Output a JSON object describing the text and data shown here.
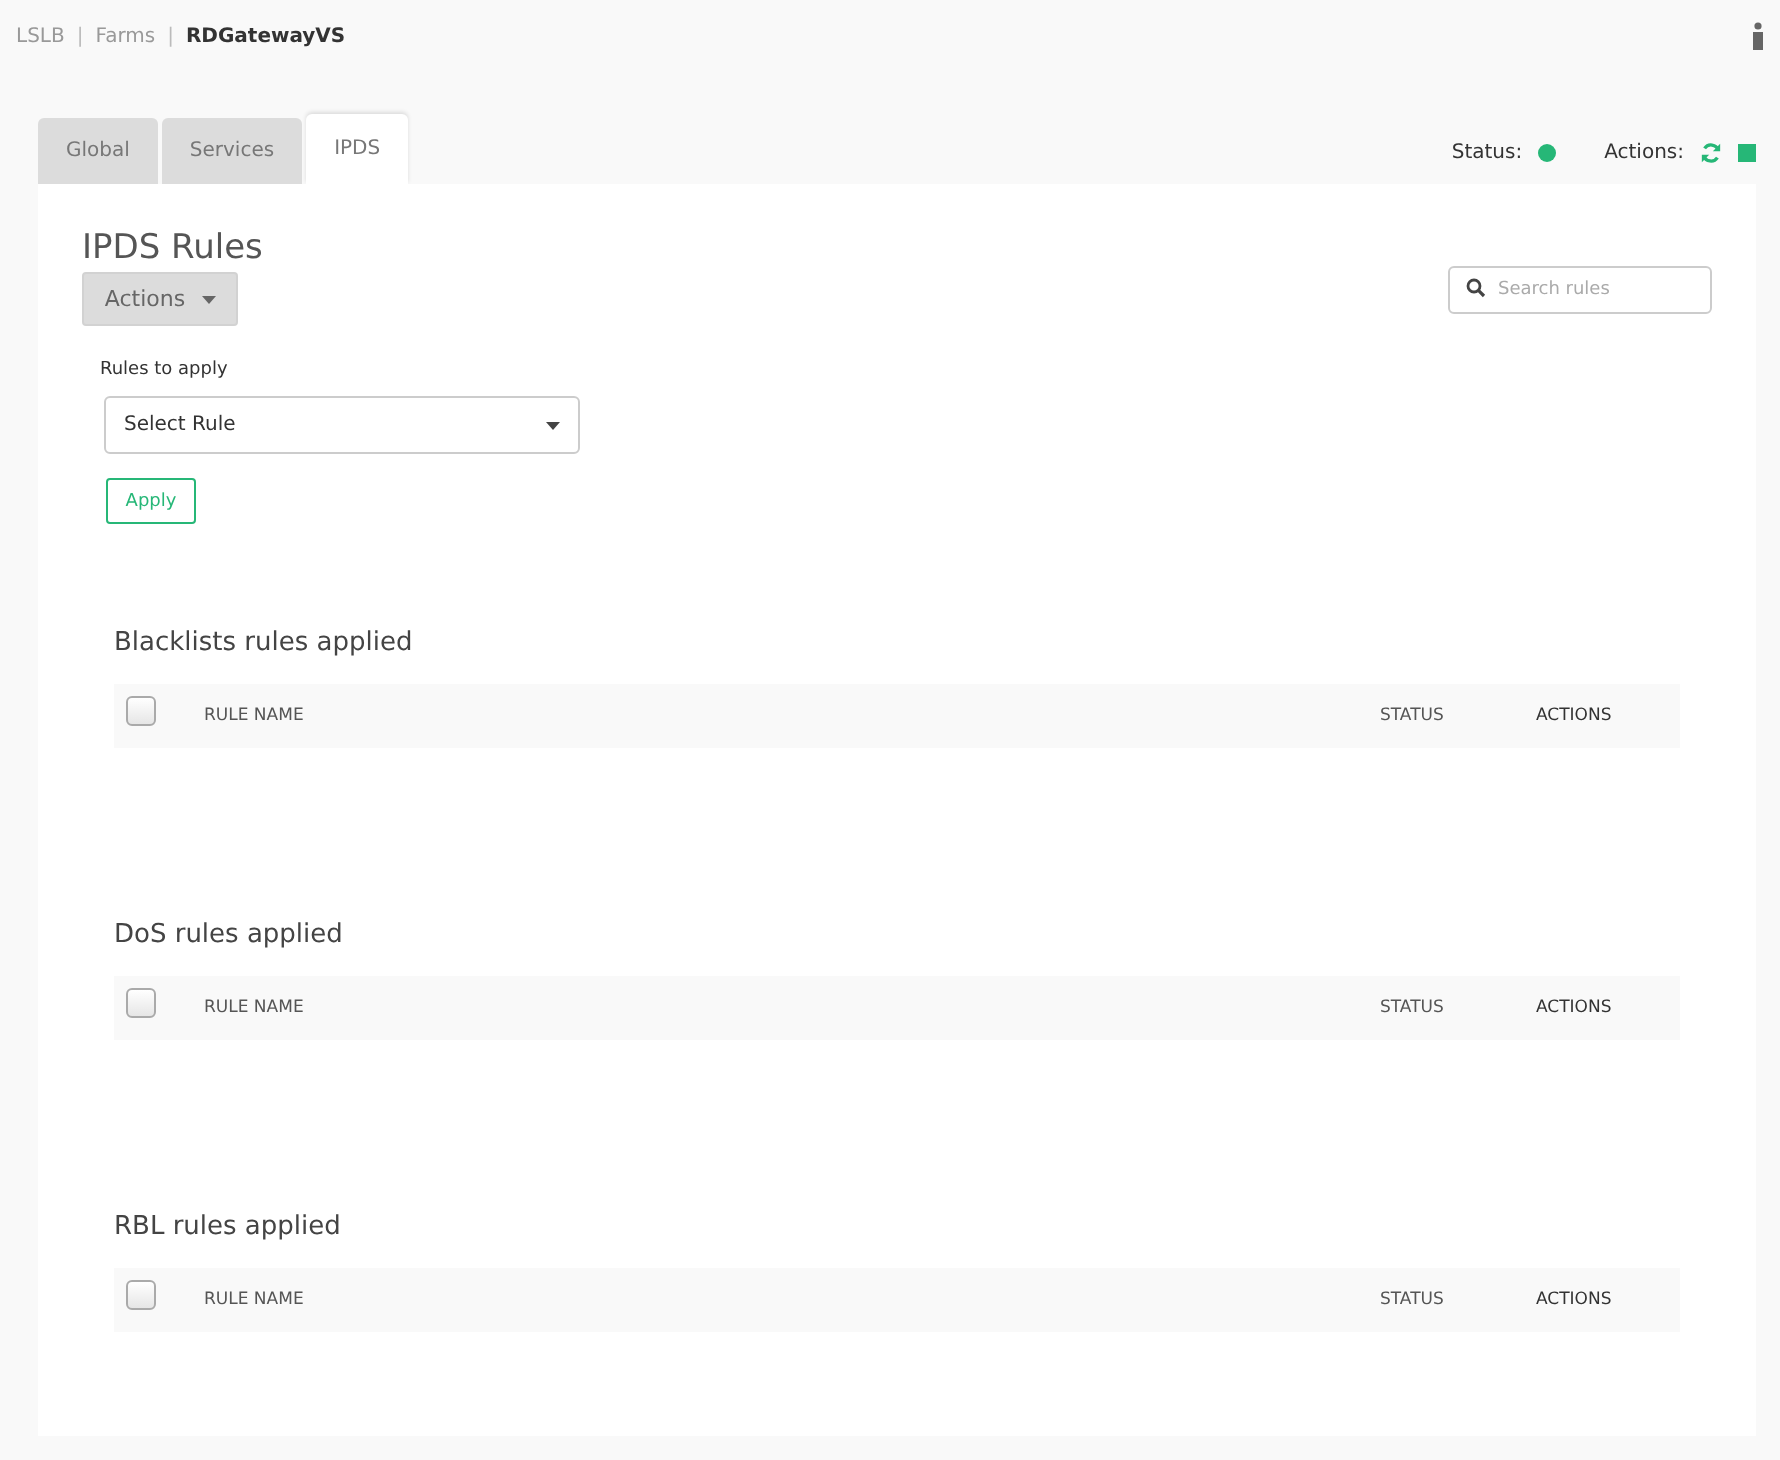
{
  "breadcrumb_separator": "|",
  "breadcrumb": [
    {
      "label": "LSLB",
      "current": false
    },
    {
      "label": "Farms",
      "current": false
    },
    {
      "label": "RDGatewayVS",
      "current": true
    }
  ],
  "tabs": [
    {
      "label": "Global",
      "selected": false
    },
    {
      "label": "Services",
      "selected": false
    },
    {
      "label": "IPDS",
      "selected": true
    }
  ],
  "status": {
    "label": "Status:",
    "color": "#26b777"
  },
  "actions": {
    "label": "Actions:"
  },
  "page_title": "IPDS Rules",
  "actions_button": "Actions",
  "search": {
    "placeholder": "Search rules"
  },
  "rules_label": "Rules to apply",
  "rule_select": {
    "value": "Select Rule"
  },
  "apply_button": "Apply",
  "sections": [
    {
      "title": "Blacklists rules applied",
      "select_all": false,
      "columns": [
        "RULE NAME",
        "STATUS",
        "ACTIONS"
      ]
    },
    {
      "title": "DoS rules applied",
      "select_all": false,
      "columns": [
        "RULE NAME",
        "STATUS",
        "ACTIONS"
      ]
    },
    {
      "title": "RBL rules applied",
      "select_all": false,
      "columns": [
        "RULE NAME",
        "STATUS",
        "ACTIONS"
      ]
    }
  ]
}
